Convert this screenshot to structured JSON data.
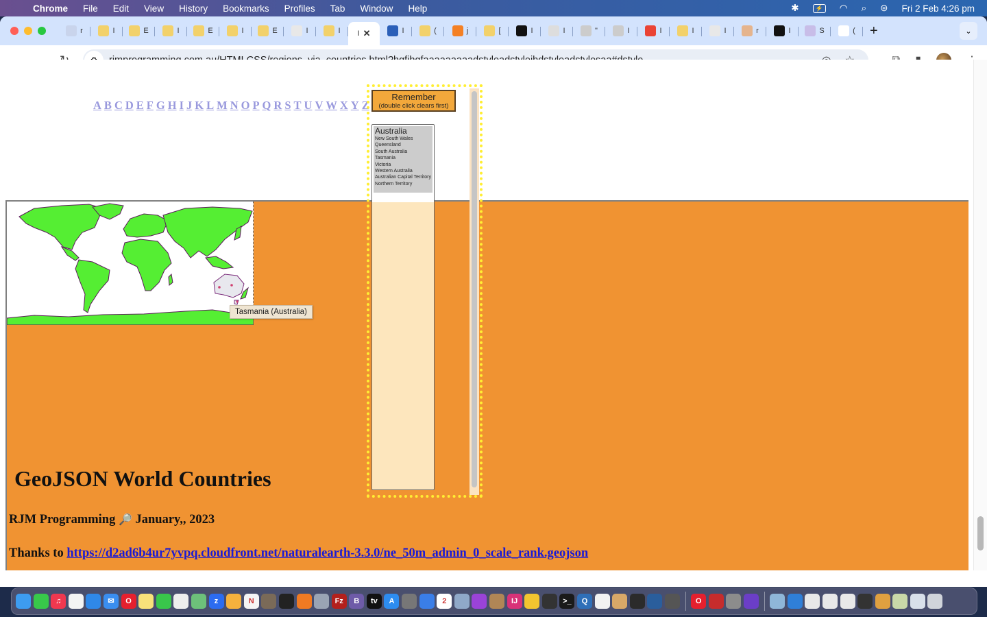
{
  "menubar": {
    "app": "Chrome",
    "items": [
      "File",
      "Edit",
      "View",
      "History",
      "Bookmarks",
      "Profiles",
      "Tab",
      "Window",
      "Help"
    ],
    "clock": "Fri 2 Feb  4:26 pm",
    "status_icons": [
      "bluetooth-icon",
      "battery-charging-icon",
      "wifi-icon",
      "spotlight-search-icon",
      "control-center-icon"
    ]
  },
  "browser": {
    "tabs": [
      {
        "icon": "gauge",
        "letter": "r",
        "color": "#c9d4ec"
      },
      {
        "icon": "pen-nib",
        "letter": "I",
        "color": "#f2d16b"
      },
      {
        "icon": "pen-nib",
        "letter": "E",
        "color": "#f2d16b"
      },
      {
        "icon": "pen-nib",
        "letter": "I",
        "color": "#f2d16b"
      },
      {
        "icon": "pen-nib",
        "letter": "E",
        "color": "#f2d16b"
      },
      {
        "icon": "pen-nib",
        "letter": "I",
        "color": "#f2d16b"
      },
      {
        "icon": "pen-nib",
        "letter": "E",
        "color": "#f2d16b"
      },
      {
        "icon": "pen-nib",
        "letter": "I",
        "color": "#e8e8e8"
      },
      {
        "icon": "pen-nib",
        "letter": "I",
        "color": "#f2d16b"
      },
      {
        "icon": "active",
        "letter": "I",
        "color": "#ffffff",
        "active": true
      },
      {
        "icon": "swirl",
        "letter": "I",
        "color": "#2b5fb8"
      },
      {
        "icon": "pen-nib",
        "letter": "(",
        "color": "#f2d16b"
      },
      {
        "icon": "stack",
        "letter": "j",
        "color": "#f48024"
      },
      {
        "icon": "pen-nib",
        "letter": "[",
        "color": "#f2d16b"
      },
      {
        "icon": "o-square",
        "letter": "I",
        "color": "#111111"
      },
      {
        "icon": "w-circle",
        "letter": "I",
        "color": "#dddddd"
      },
      {
        "icon": "fingerprint",
        "letter": "\"",
        "color": "#cccccc"
      },
      {
        "icon": "s-circle",
        "letter": "I",
        "color": "#cccccc"
      },
      {
        "icon": "gmail",
        "letter": "I",
        "color": "#ea4335"
      },
      {
        "icon": "pen-nib",
        "letter": "I",
        "color": "#f2d16b"
      },
      {
        "icon": "pen-nib",
        "letter": "I",
        "color": "#e8e8e8"
      },
      {
        "icon": "gauge",
        "letter": "r",
        "color": "#e5b48d"
      },
      {
        "icon": "o-square",
        "letter": "I",
        "color": "#111111"
      },
      {
        "icon": "ai-circle",
        "letter": "S",
        "color": "#c8bde8"
      },
      {
        "icon": "google",
        "letter": "(",
        "color": "#ffffff"
      }
    ],
    "url": "rjmprogramming.com.au/HTMLCSS/regions_via_countries.html?hgfjhgfaaaaaaaaadstyleadstylejhdstyleadstylesaa#dstyle"
  },
  "page": {
    "letters": [
      "A",
      "B",
      "C",
      "D",
      "E",
      "F",
      "G",
      "H",
      "I",
      "J",
      "K",
      "L",
      "M",
      "N",
      "O",
      "P",
      "Q",
      "R",
      "S",
      "T",
      "U",
      "V",
      "W",
      "X",
      "Y",
      "Z"
    ],
    "remember_button": {
      "line1": "Remember",
      "line2": "(double click clears first)"
    },
    "region_list": {
      "country": "Australia",
      "regions": [
        "New South Wales",
        "Queensland",
        "South Australia",
        "Tasmania",
        "Victoria",
        "Western Australia",
        "Australian Capital Territory",
        "Northern Territory"
      ]
    },
    "map_tooltip": "Tasmania (Australia)",
    "map_colors": {
      "land": "#55ee33",
      "border": "#5a1a5a",
      "highlight": "#e8e8ee"
    },
    "title": "GeoJSON World Countries",
    "byline": {
      "author": "RJM Programming",
      "magnifier": "🔎",
      "date": "January,, 2023"
    },
    "thanks": {
      "prefix": "Thanks to ",
      "link": "https://d2ad6b4ur7yvpq.cloudfront.net/naturalearth-3.3.0/ne_50m_admin_0_scale_rank.geojson"
    },
    "colors": {
      "orange_bg": "#f09332",
      "panel_dots": "#ffee33",
      "letters": "#9999dd",
      "link": "#1a1ad6"
    }
  },
  "dock": {
    "apps": [
      {
        "name": "finder",
        "color": "#3d9cf0",
        "t": ""
      },
      {
        "name": "messages",
        "color": "#38c94a",
        "t": ""
      },
      {
        "name": "music",
        "color": "#f0384f",
        "t": "♫"
      },
      {
        "name": "reminders",
        "color": "#f4f4f4",
        "t": ""
      },
      {
        "name": "safari",
        "color": "#2f88e8",
        "t": ""
      },
      {
        "name": "mail",
        "color": "#3a8ef0",
        "t": "✉"
      },
      {
        "name": "opera",
        "color": "#e5202e",
        "t": "O"
      },
      {
        "name": "notes",
        "color": "#f8e27a",
        "t": ""
      },
      {
        "name": "facetime",
        "color": "#39c64b",
        "t": ""
      },
      {
        "name": "document",
        "color": "#eeeeee",
        "t": ""
      },
      {
        "name": "maps",
        "color": "#6dc07a",
        "t": ""
      },
      {
        "name": "zoom",
        "color": "#2c6cf0",
        "t": "z"
      },
      {
        "name": "photos",
        "color": "#f5b13d",
        "t": ""
      },
      {
        "name": "news",
        "color": "#f5f5f5",
        "t": "N"
      },
      {
        "name": "gimp",
        "color": "#7a6a58",
        "t": ""
      },
      {
        "name": "terminal-dark",
        "color": "#222222",
        "t": ""
      },
      {
        "name": "firefox",
        "color": "#f17a22",
        "t": ""
      },
      {
        "name": "launchpad",
        "color": "#9aa4b4",
        "t": ""
      },
      {
        "name": "filezilla",
        "color": "#b3201c",
        "t": "Fz"
      },
      {
        "name": "bbedit",
        "color": "#6e5ba8",
        "t": "B"
      },
      {
        "name": "apple-tv",
        "color": "#111111",
        "t": "tv"
      },
      {
        "name": "app-store",
        "color": "#2d8cf0",
        "t": "A"
      },
      {
        "name": "calculator",
        "color": "#777777",
        "t": ""
      },
      {
        "name": "xcode",
        "color": "#3a7ee8",
        "t": ""
      },
      {
        "name": "calendar",
        "color": "#ffffff",
        "t": "2"
      },
      {
        "name": "preview",
        "color": "#8fa8c8",
        "t": ""
      },
      {
        "name": "podcasts",
        "color": "#9a43d8",
        "t": ""
      },
      {
        "name": "contacts",
        "color": "#b08656",
        "t": ""
      },
      {
        "name": "intellij",
        "color": "#d83278",
        "t": "IJ"
      },
      {
        "name": "chrome",
        "color": "#f2c530",
        "t": ""
      },
      {
        "name": "inkscape",
        "color": "#333333",
        "t": ""
      },
      {
        "name": "terminal",
        "color": "#1a1a1a",
        "t": ">_"
      },
      {
        "name": "quicktime",
        "color": "#2f6fb8",
        "t": "Q"
      },
      {
        "name": "textedit",
        "color": "#f2f2f2",
        "t": ""
      },
      {
        "name": "paintbrush",
        "color": "#d8a868",
        "t": ""
      },
      {
        "name": "console",
        "color": "#2b2b2b",
        "t": ""
      },
      {
        "name": "affinity",
        "color": "#2a5e9c",
        "t": ""
      },
      {
        "name": "elephant",
        "color": "#555555",
        "t": ""
      },
      {
        "name": "sep"
      },
      {
        "name": "opera-gx",
        "color": "#e5202e",
        "t": "O"
      },
      {
        "name": "compass",
        "color": "#c62c2c",
        "t": ""
      },
      {
        "name": "system-settings",
        "color": "#8c8c8c",
        "t": ""
      },
      {
        "name": "firefox-dev",
        "color": "#6b3ec7",
        "t": ""
      },
      {
        "name": "sep"
      },
      {
        "name": "screenshot-1",
        "color": "#8fb6d8",
        "t": ""
      },
      {
        "name": "globe",
        "color": "#2f7fd8",
        "t": ""
      },
      {
        "name": "window-1",
        "color": "#e8e8e8",
        "t": ""
      },
      {
        "name": "window-2",
        "color": "#e8e8e8",
        "t": ""
      },
      {
        "name": "window-3",
        "color": "#e8e8e8",
        "t": ""
      },
      {
        "name": "calendar-mini",
        "color": "#333333",
        "t": ""
      },
      {
        "name": "chrome-mini",
        "color": "#e0a040",
        "t": ""
      },
      {
        "name": "screenshot-2",
        "color": "#c8d8a8",
        "t": ""
      },
      {
        "name": "screenshot-3",
        "color": "#d8e0ea",
        "t": ""
      },
      {
        "name": "trash",
        "color": "#d0d4da",
        "t": ""
      }
    ]
  }
}
